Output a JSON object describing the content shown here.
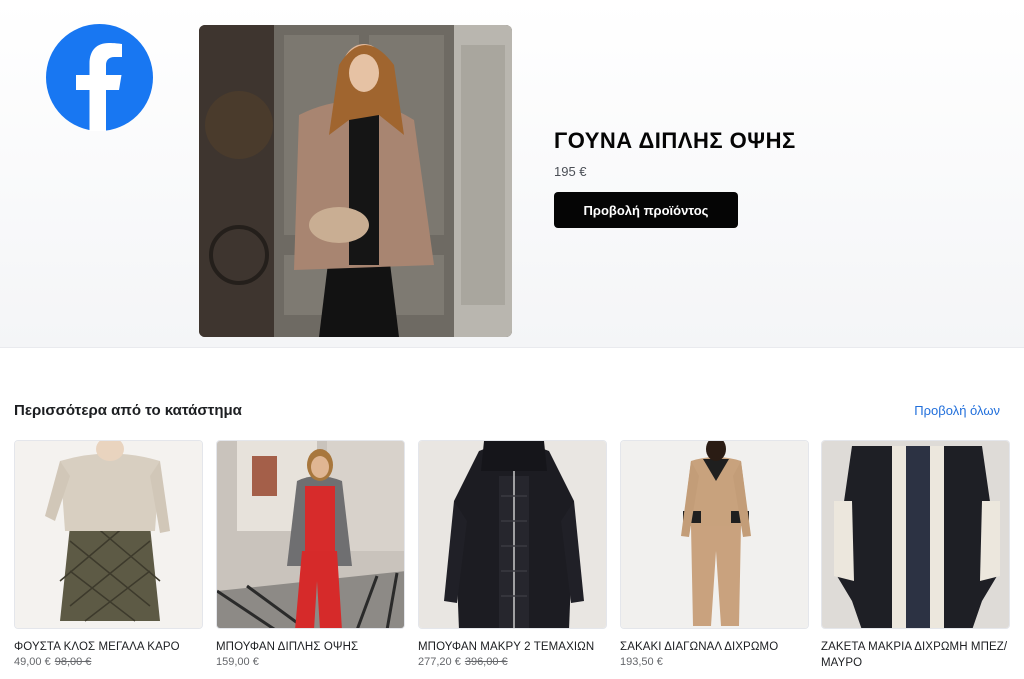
{
  "hero": {
    "logo": "facebook-logo",
    "title": "ΓΟΥΝΑ ΔΙΠΛΗΣ ΟΨΗΣ",
    "price": "195 €",
    "button_label": "Προβολή προϊόντος"
  },
  "more": {
    "title": "Περισσότερα από το κατάστημα",
    "view_all": "Προβολή όλων"
  },
  "products": [
    {
      "name": "ΦΟΥΣΤΑ ΚΛΟΣ ΜΕΓΑΛΑ ΚΑΡΟ",
      "price": "49,00 €",
      "old_price": "98,00 €"
    },
    {
      "name": "ΜΠΟΥΦΑΝ ΔΙΠΛΗΣ ΟΨΗΣ",
      "price": "159,00 €",
      "old_price": ""
    },
    {
      "name": "ΜΠΟΥΦΑΝ ΜΑΚΡΥ 2 ΤΕΜΑΧΙΩΝ",
      "price": "277,20 €",
      "old_price": "396,00 €"
    },
    {
      "name": "ΣΑΚΑΚΙ ΔΙΑΓΩΝΑΛ ΔΙΧΡΩΜΟ",
      "price": "193,50 €",
      "old_price": ""
    },
    {
      "name": "ΖΑΚΕΤΑ ΜΑΚΡΙΑ ΔΙΧΡΩΜΗ ΜΠΕΖ/ΜΑΥΡΟ",
      "price": "",
      "old_price": ""
    }
  ],
  "colors": {
    "brand": "#1877f2",
    "link": "#216fdb",
    "button": "#050505"
  }
}
